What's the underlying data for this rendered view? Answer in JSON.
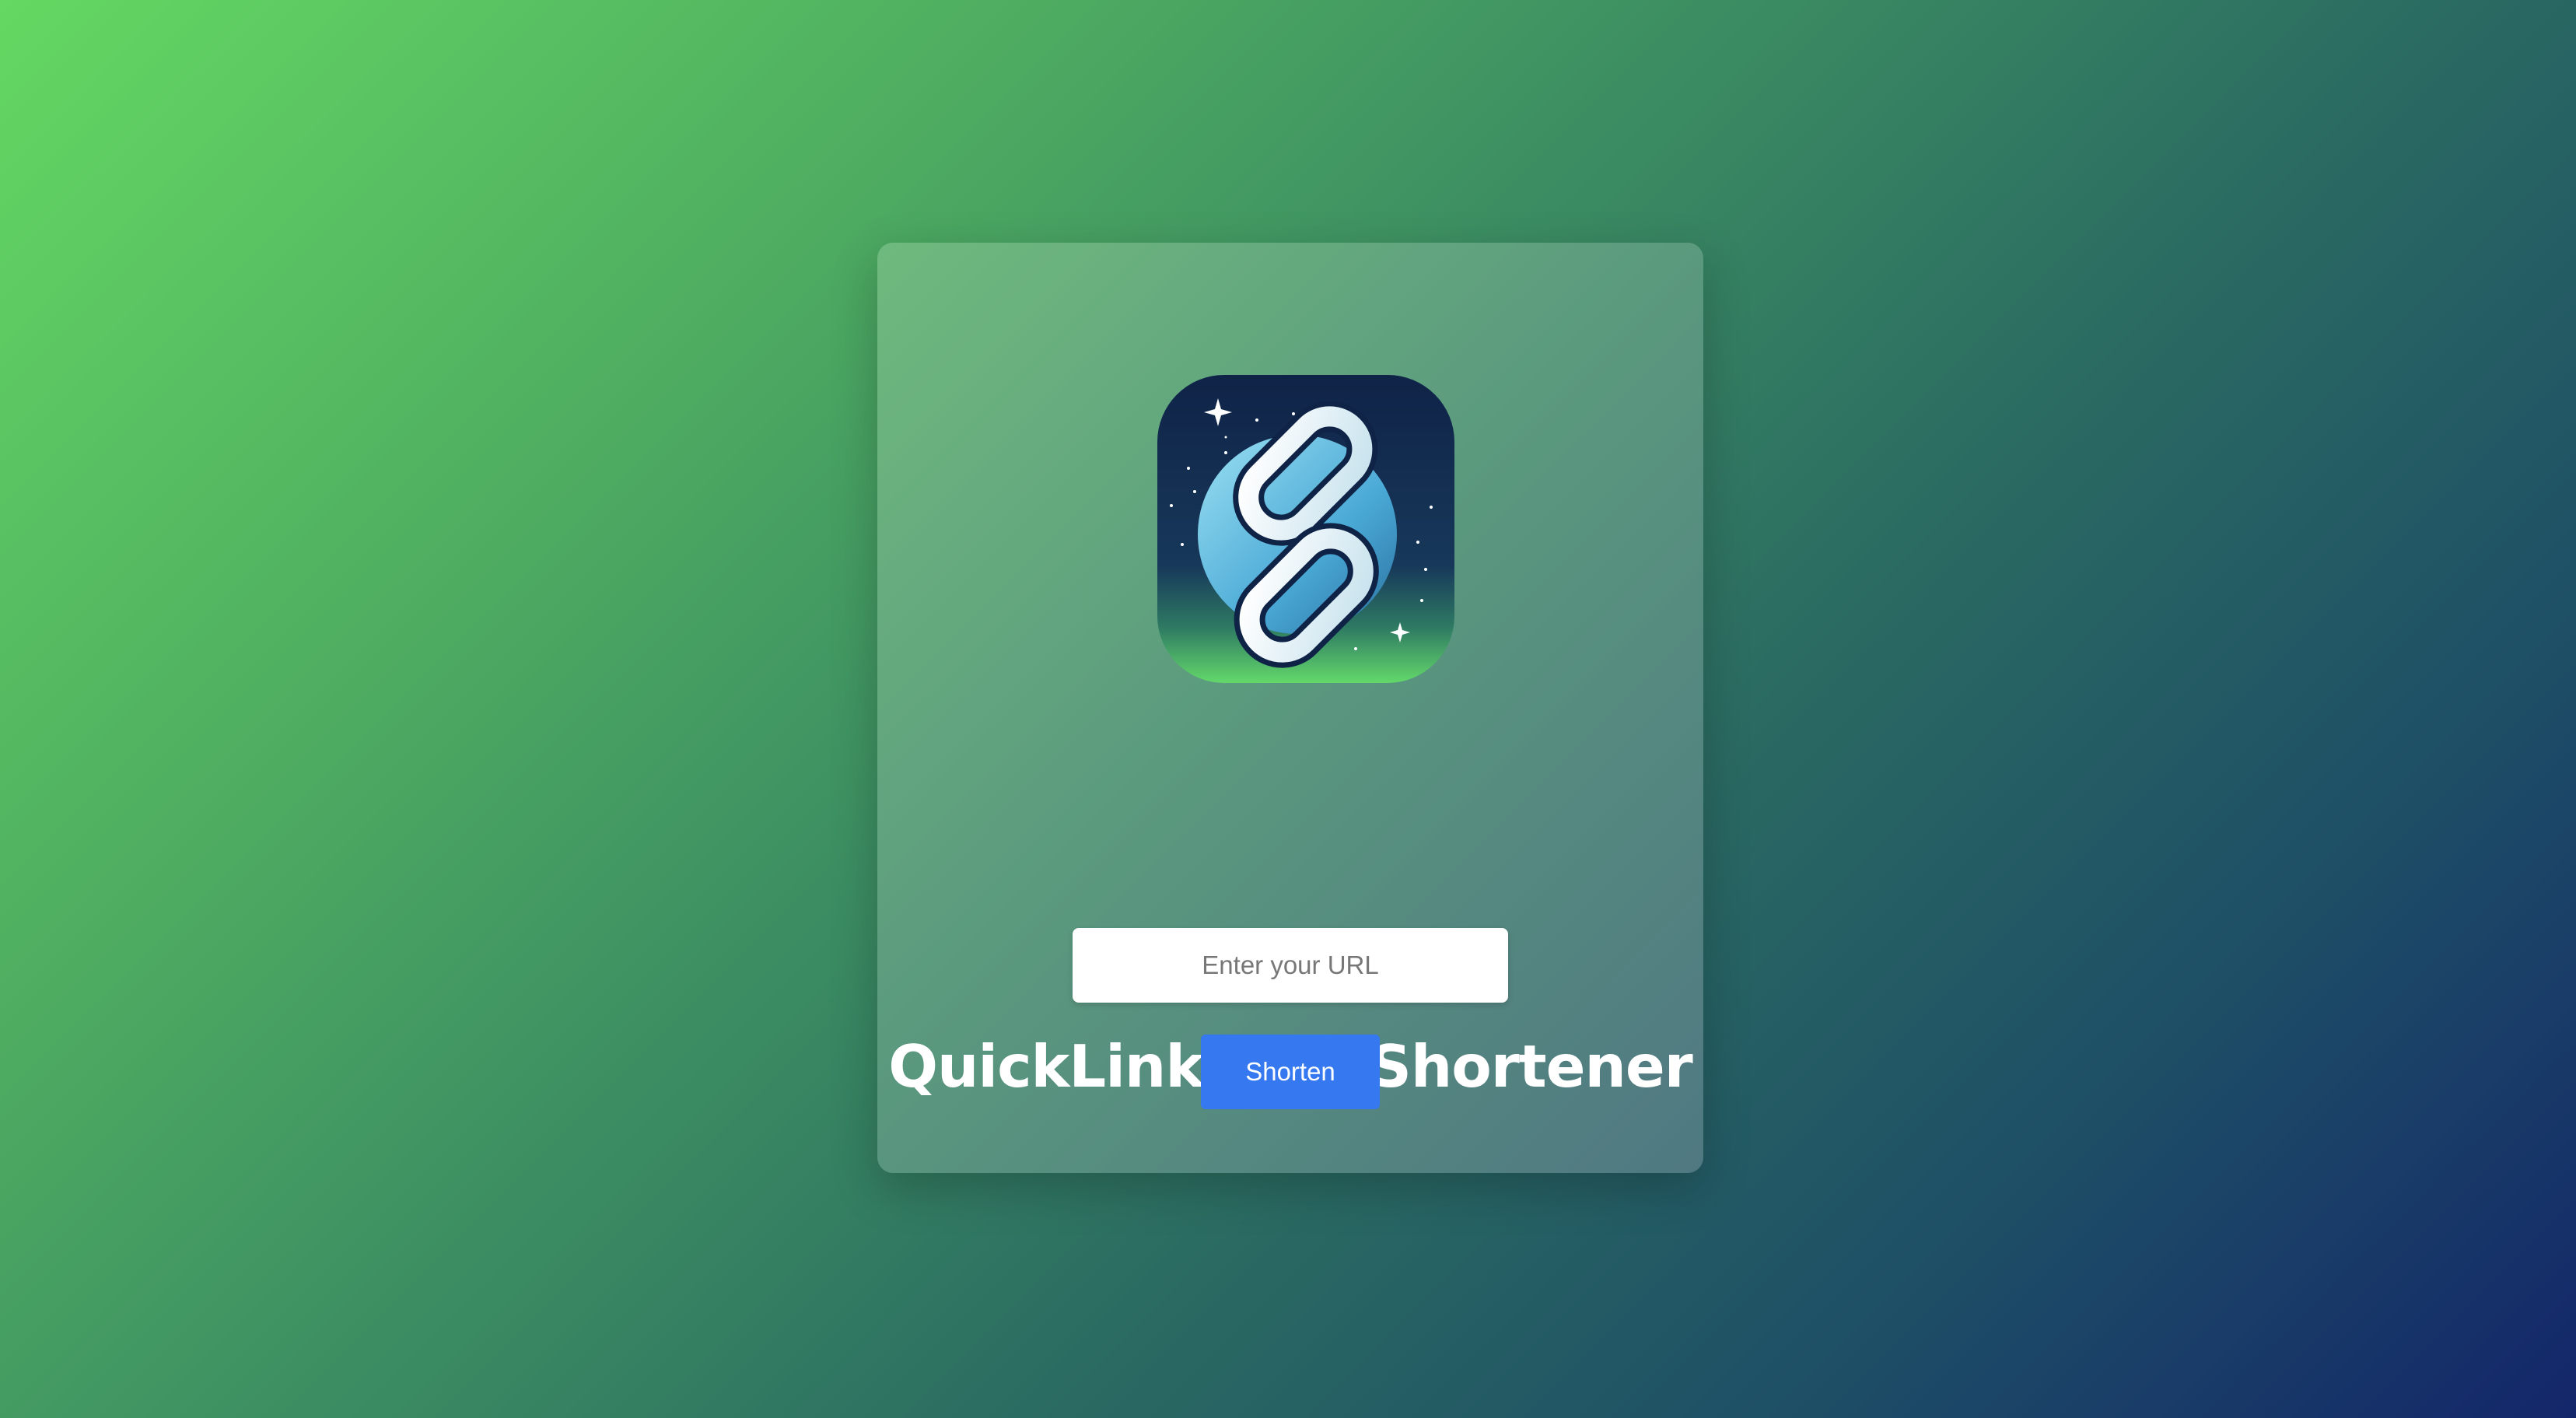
{
  "app": {
    "title": "QuickLink URL Shortener",
    "logo_icon": "chain-link-icon"
  },
  "form": {
    "url_placeholder": "Enter your URL",
    "url_value": "",
    "submit_label": "Shorten"
  },
  "colors": {
    "background_start": "#64d862",
    "background_end": "#13266a",
    "button": "#3578f0",
    "title_text": "#ffffff"
  }
}
